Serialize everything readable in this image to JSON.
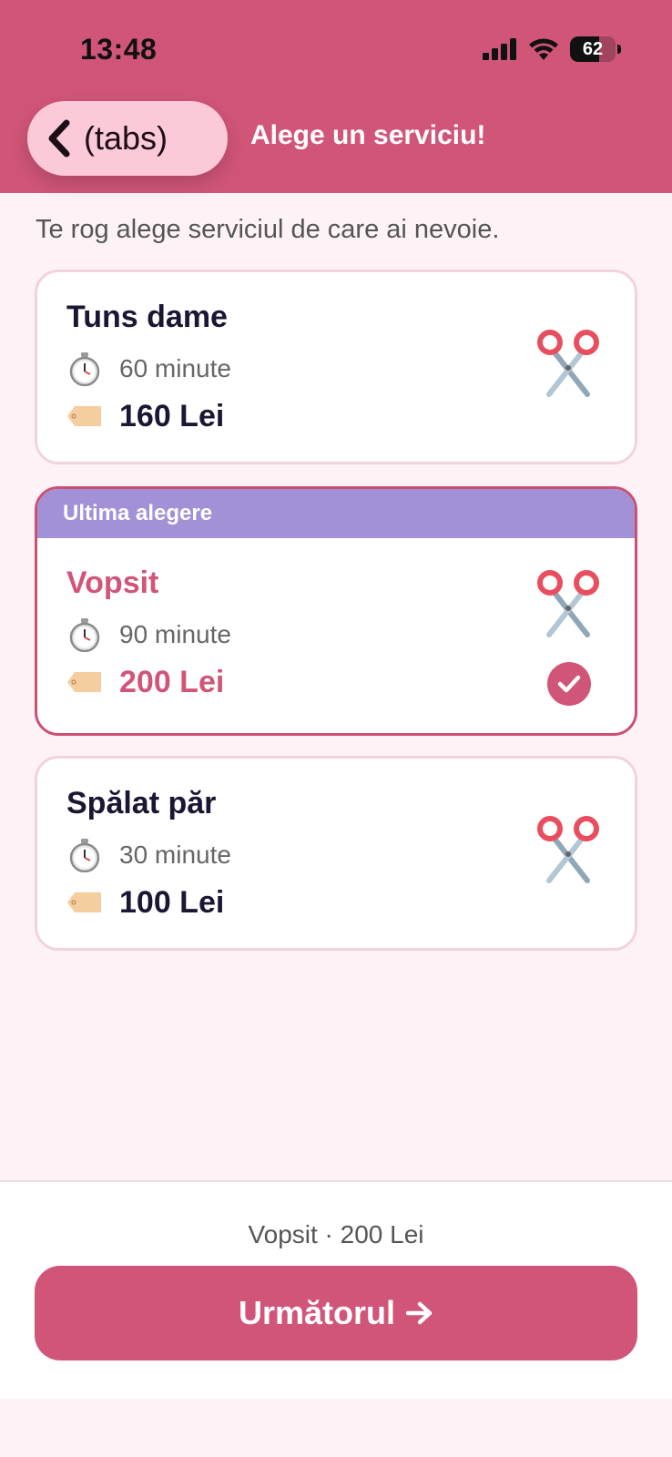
{
  "status_bar": {
    "time": "13:48",
    "battery": "62"
  },
  "header": {
    "back_label": "(tabs)",
    "title": "Alege un serviciu!"
  },
  "subtitle": "Te rog alege serviciul de care ai nevoie.",
  "services": [
    {
      "name": "Tuns dame",
      "duration": "60 minute",
      "price": "160 Lei"
    },
    {
      "banner": "Ultima alegere",
      "name": "Vopsit",
      "duration": "90 minute",
      "price": "200 Lei",
      "selected": true
    },
    {
      "name": "Spălat păr",
      "duration": "30 minute",
      "price": "100 Lei"
    }
  ],
  "footer": {
    "summary": "Vopsit · 200 Lei",
    "next_label": "Următorul"
  },
  "colors": {
    "brand": "#d15579",
    "banner": "#a291d6",
    "light_pink": "#fbc9d8",
    "background": "#fdf2f5"
  },
  "icons": [
    "chevron-left-icon",
    "signal-icon",
    "wifi-icon",
    "battery-icon",
    "stopwatch-icon",
    "price-tag-icon",
    "scissors-icon",
    "checkmark-icon",
    "arrow-right-icon"
  ]
}
